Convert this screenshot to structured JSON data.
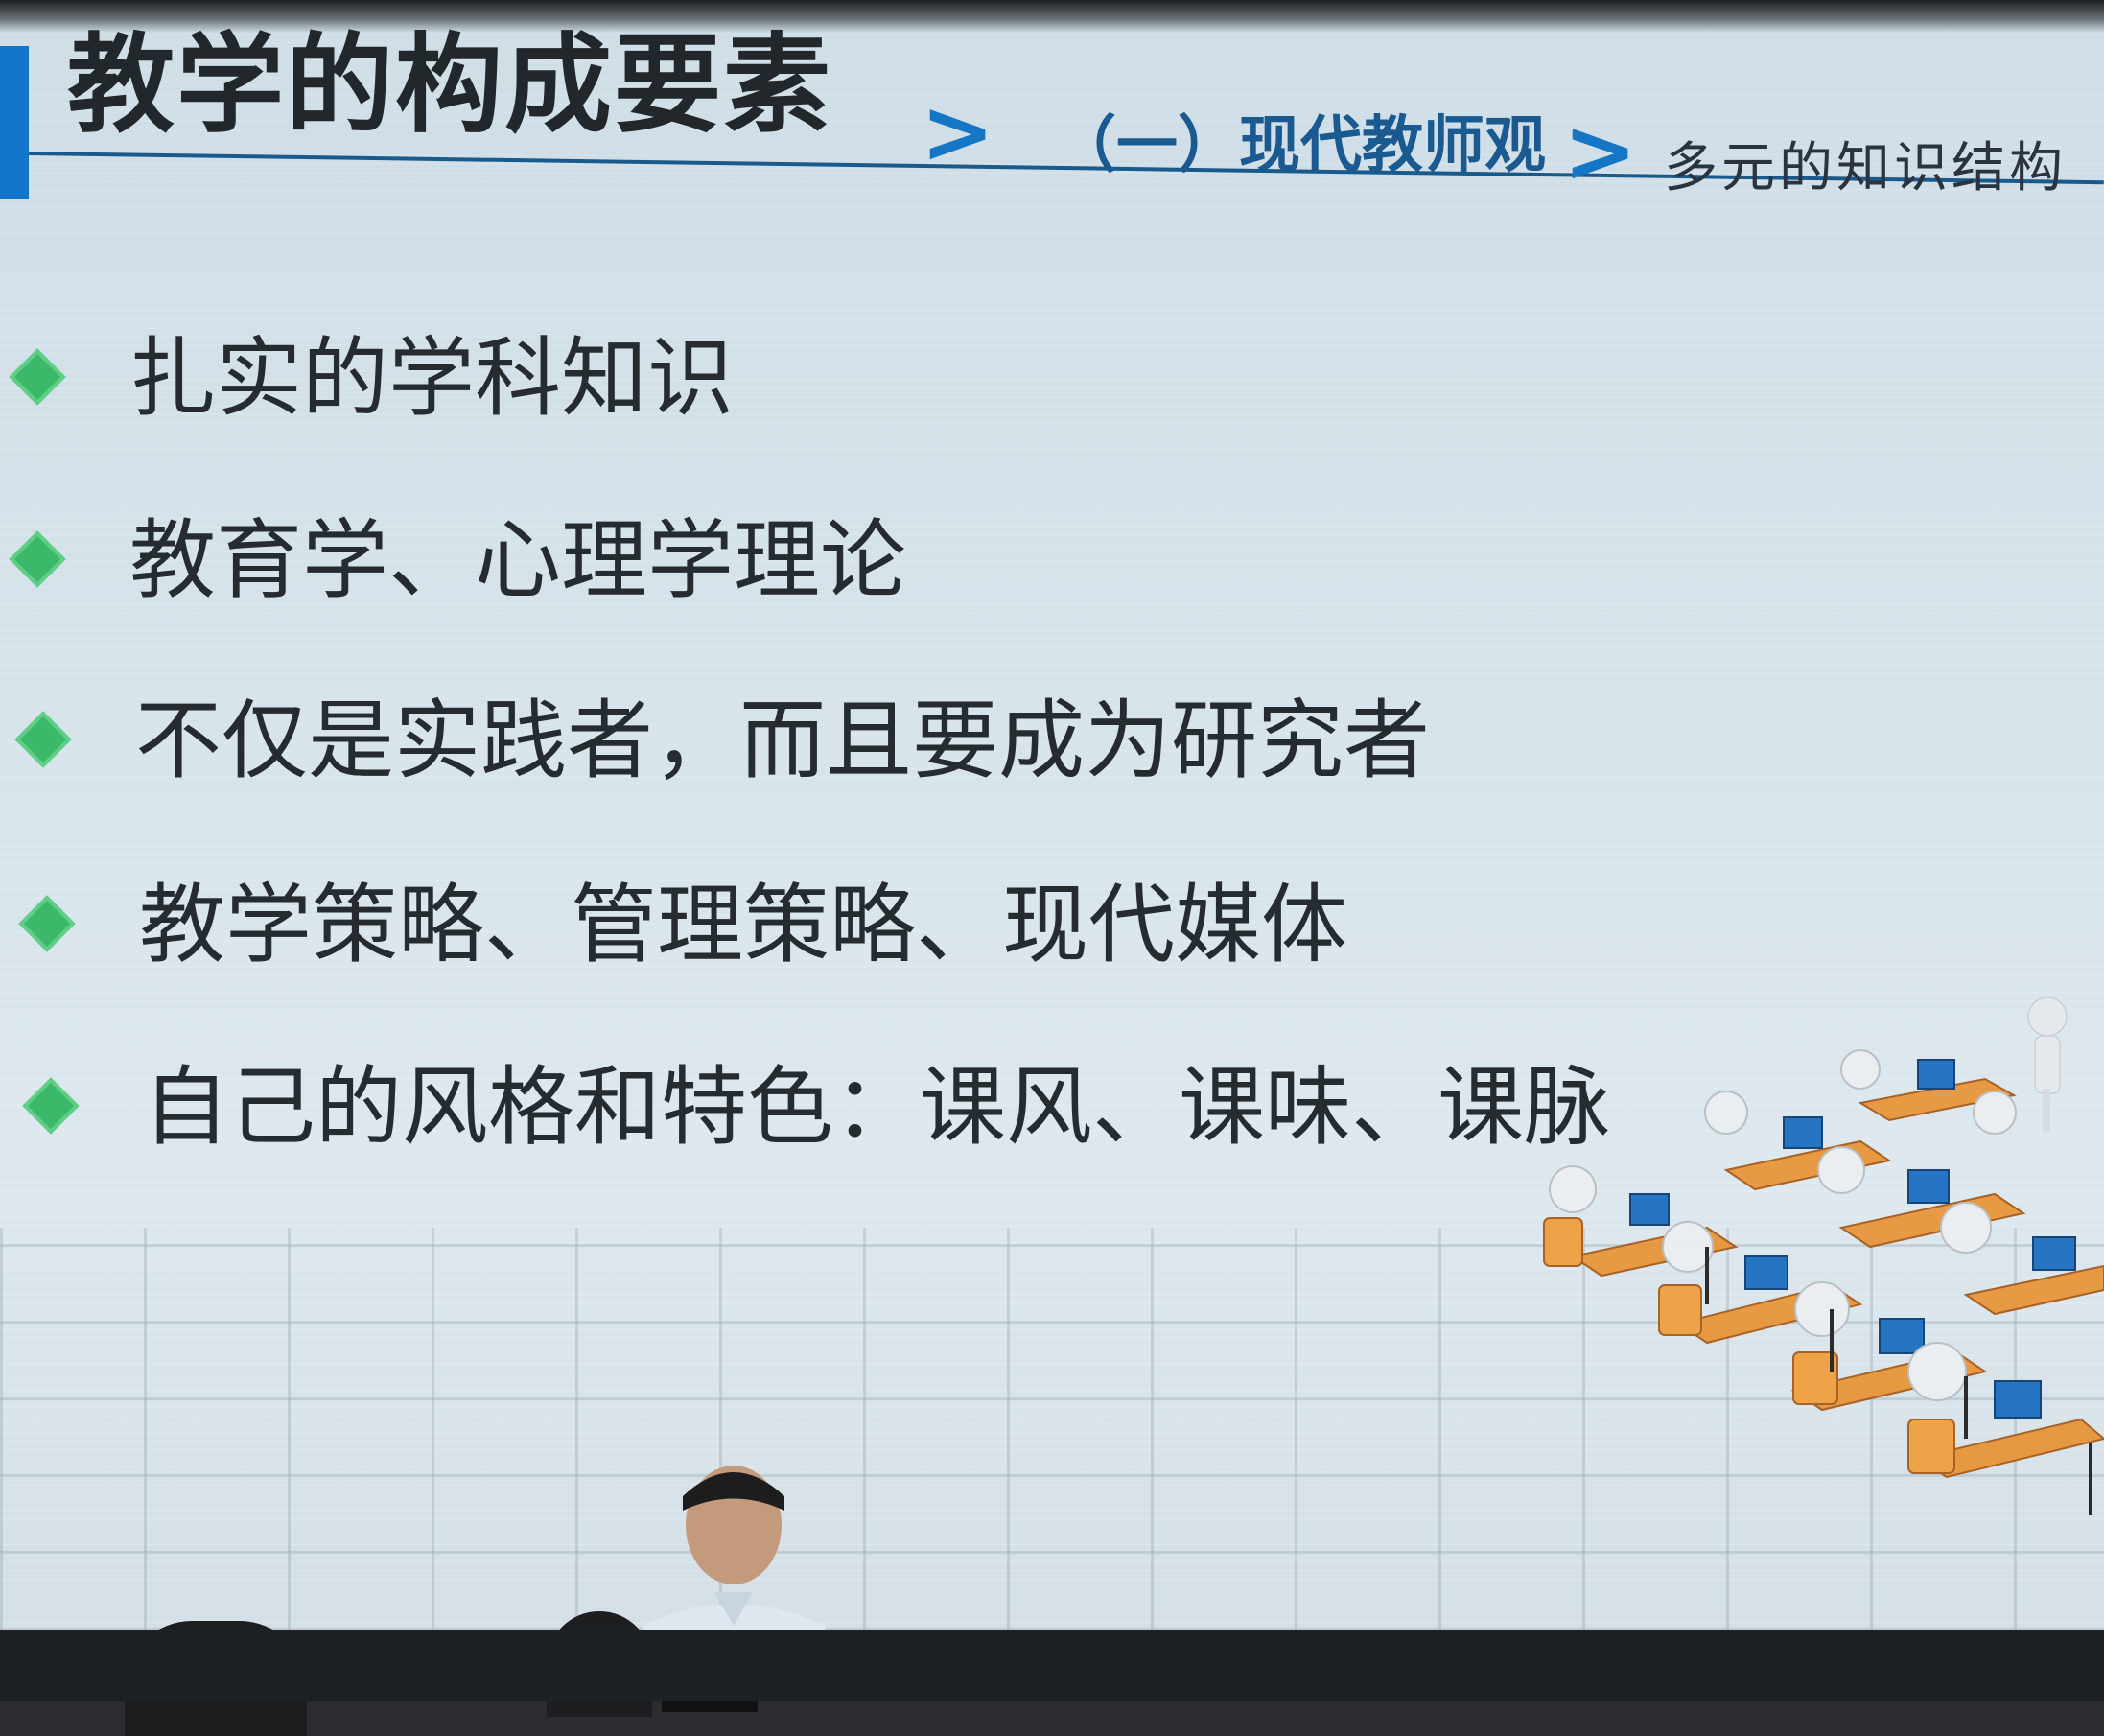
{
  "slide": {
    "title": "教学的构成要素",
    "breadcrumb_1": "（一）现代教师观",
    "breadcrumb_2": "多元的知识结构",
    "chevron": ">",
    "bullets": [
      {
        "text": "扎实的学科知识"
      },
      {
        "text": "教育学、心理学理论"
      },
      {
        "text": "不仅是实践者，而且要成为研究者"
      },
      {
        "text": "教学策略、管理策略、现代媒体"
      },
      {
        "text": "自己的风格和特色：课风、课味、课脉"
      }
    ],
    "colors": {
      "accent_blue": "#1176c9",
      "bullet_green": "#3bb86a",
      "text": "#262b30"
    },
    "icons": [
      "diamond-bullet-icon",
      "chevron-right-icon",
      "classroom-illustration"
    ]
  }
}
